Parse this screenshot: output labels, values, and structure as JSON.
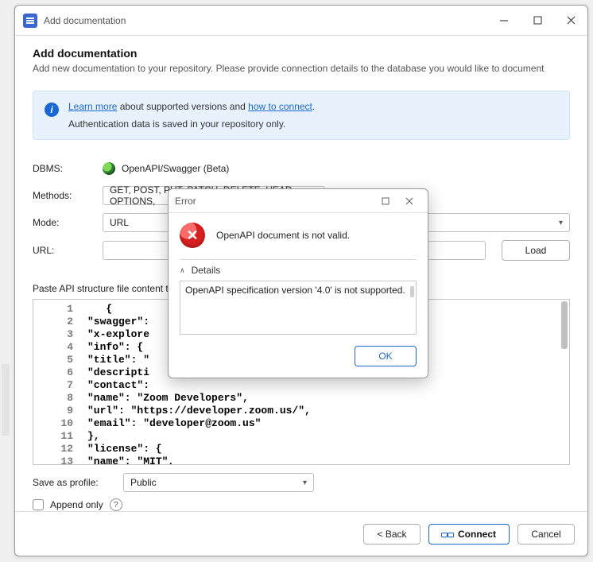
{
  "window": {
    "title": "Add documentation"
  },
  "header": {
    "title": "Add documentation",
    "subtitle": "Add new documentation to your repository. Please provide connection details to the database you would like to document"
  },
  "infobar": {
    "learn_more": "Learn more",
    "middle": " about supported versions and ",
    "how_to_connect": "how to connect",
    "period": ".",
    "line2": "Authentication data is saved in your repository only."
  },
  "form": {
    "dbms_label": "DBMS:",
    "dbms_value": "OpenAPI/Swagger (Beta)",
    "methods_label": "Methods:",
    "methods_value": "GET, POST, PUT, PATCH, DELETE, HEAD, OPTIONS,",
    "mode_label": "Mode:",
    "mode_value": "URL",
    "url_label": "URL:",
    "url_value": "",
    "load_btn": "Load"
  },
  "paste_label": "Paste API structure file content to",
  "code": {
    "lines": [
      "   {",
      "\"swagger\":",
      "\"x-explore",
      "\"info\": {",
      "\"title\": \"",
      "\"descripti",
      "\"contact\":",
      "\"name\": \"Zoom Developers\",",
      "\"url\": \"https://developer.zoom.us/\",",
      "\"email\": \"developer@zoom.us\"",
      "},",
      "\"license\": {",
      "\"name\": \"MIT\","
    ],
    "start_line": 1
  },
  "save": {
    "label": "Save as profile:",
    "value": "Public",
    "append_label": "Append only"
  },
  "footer": {
    "back": "< Back",
    "connect": "Connect",
    "cancel": "Cancel"
  },
  "dialog": {
    "title": "Error",
    "message": "OpenAPI document is not valid.",
    "details_label": "Details",
    "details_text": "OpenAPI specification version '4.0' is not supported.",
    "ok": "OK"
  }
}
